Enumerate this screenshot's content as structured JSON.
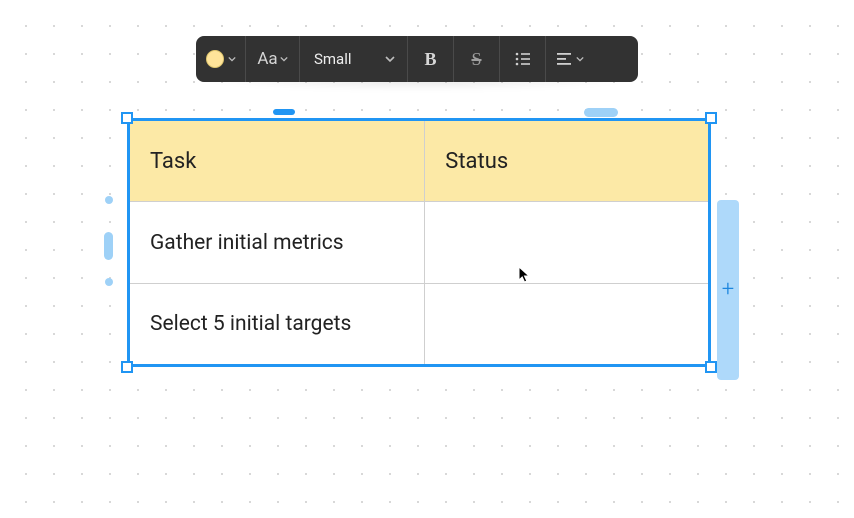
{
  "toolbar": {
    "color_swatch": "#ffe49a",
    "font_button_label": "Aa",
    "size_label": "Small",
    "bold_label": "B",
    "strike_label": "S",
    "list_label": "list",
    "align_label": "align-left"
  },
  "table": {
    "headers": {
      "col1": "Task",
      "col2": "Status"
    },
    "rows": [
      {
        "task": "Gather initial metrics",
        "status": ""
      },
      {
        "task": "Select 5 initial targets",
        "status": ""
      }
    ]
  },
  "add_column": {
    "glyph": "+"
  }
}
